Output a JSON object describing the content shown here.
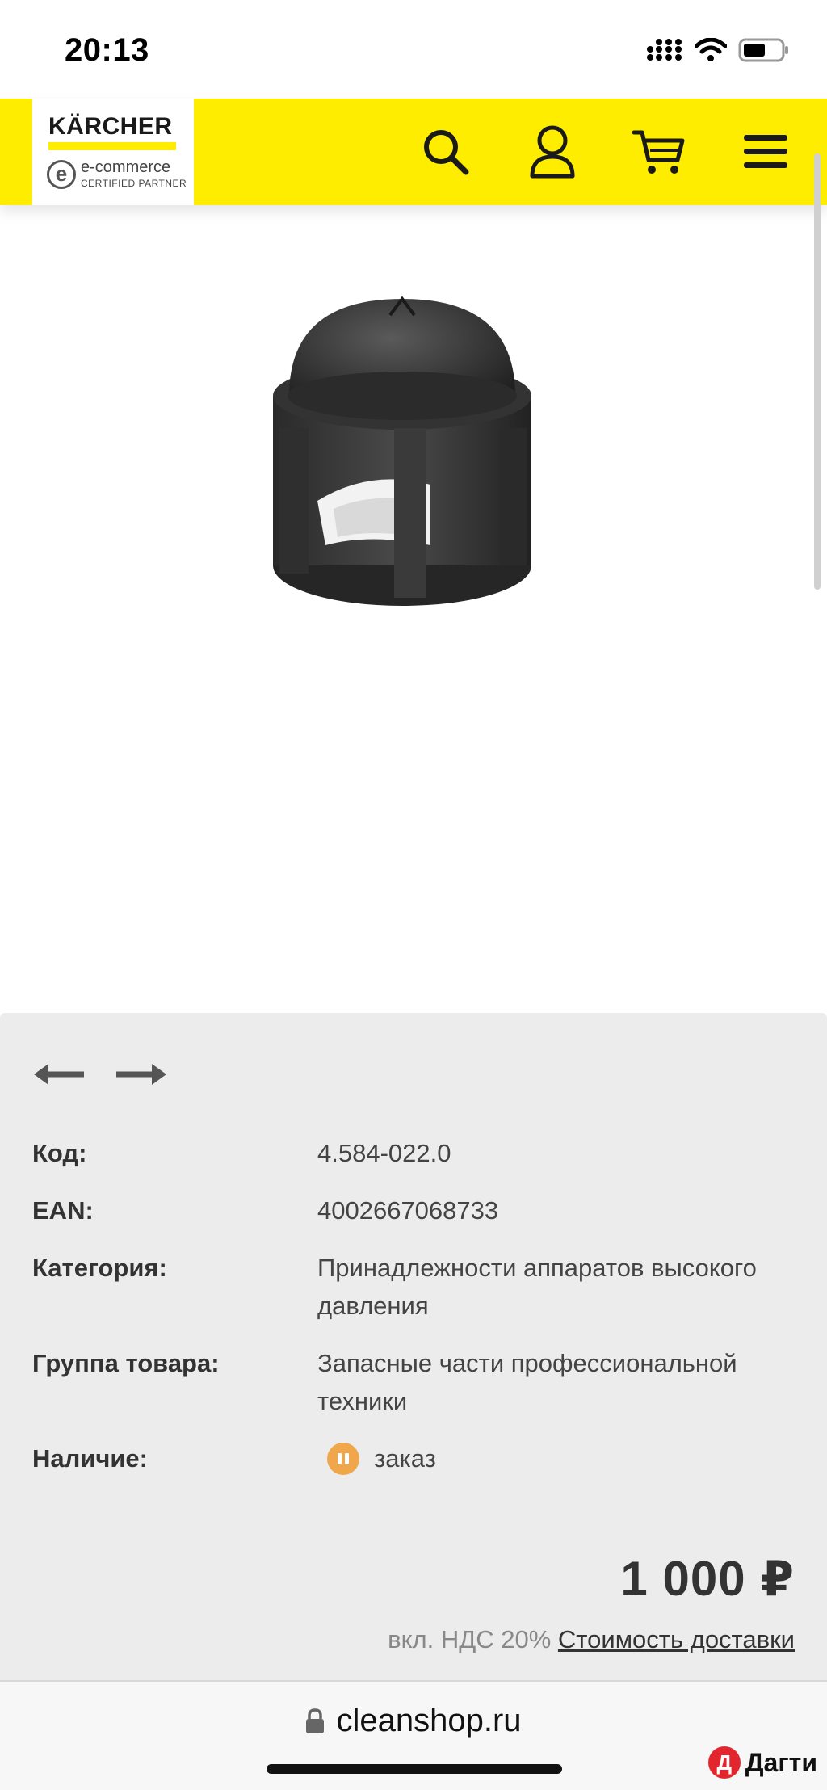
{
  "status_bar": {
    "time": "20:13"
  },
  "header": {
    "logo_brand": "KÄRCHER",
    "logo_badge": "e",
    "logo_tagline": "e-commerce",
    "logo_subtagline": "CERTIFIED PARTNER",
    "accent_color": "#ffed00",
    "icons": [
      "search-icon",
      "user-icon",
      "cart-icon",
      "menu-icon"
    ]
  },
  "product": {
    "specs": [
      {
        "label": "Код:",
        "value": "4.584-022.0"
      },
      {
        "label": "EAN:",
        "value": "4002667068733"
      },
      {
        "label": "Категория:",
        "value": "Принадлежности аппаратов высокого давления"
      },
      {
        "label": "Группа товара:",
        "value": "Запасные части профессиональной техники"
      },
      {
        "label": "Наличие:",
        "value": "заказ"
      }
    ],
    "availability_color": "#f0a64a",
    "price": "1 000 ₽",
    "vat_note": "вкл. НДС 20%",
    "delivery_link": "Стоимость доставки"
  },
  "browser": {
    "url": "cleanshop.ru",
    "badge_letter": "Д",
    "badge_text": "Дагти"
  }
}
